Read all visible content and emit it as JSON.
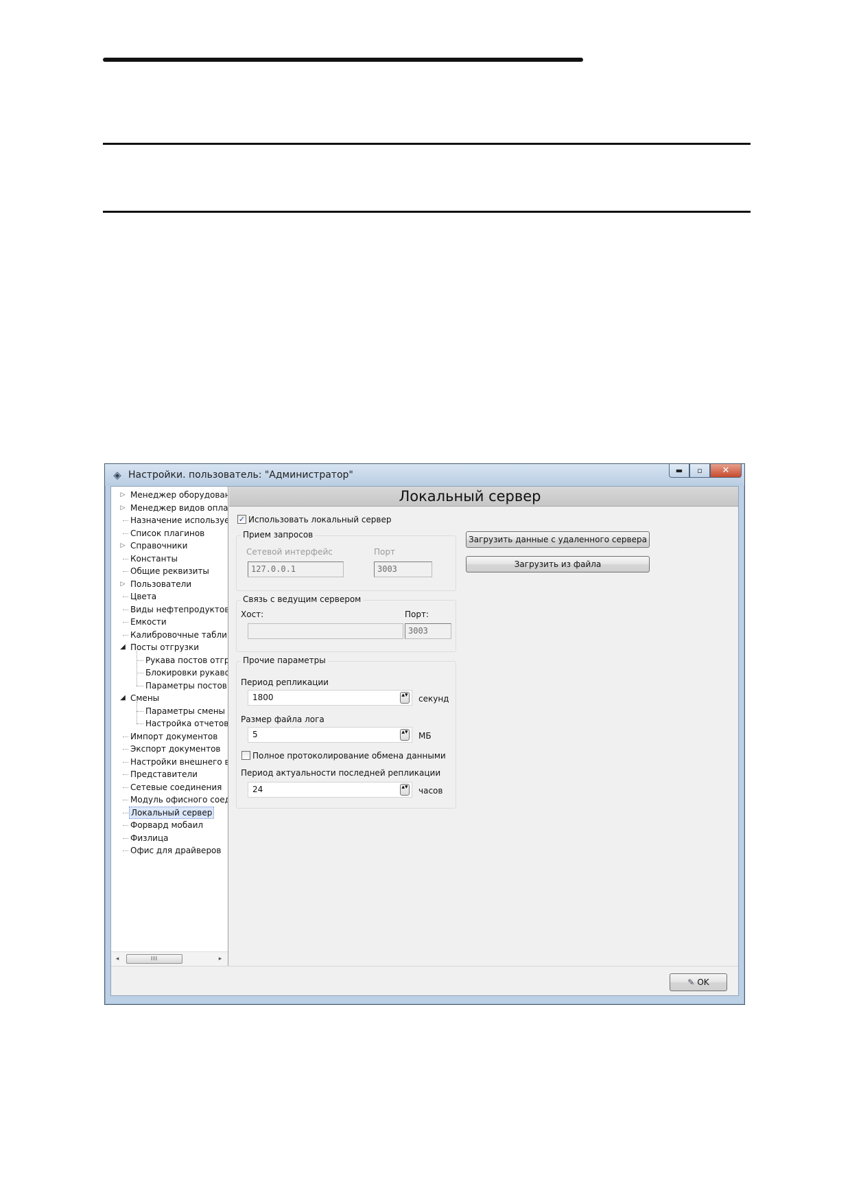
{
  "window": {
    "title": "Настройки. пользователь: \"Администратор\"",
    "minimize_glyph": "▬",
    "maximize_glyph": "▫",
    "close_glyph": "✕"
  },
  "tree": {
    "items": [
      {
        "label": "Менеджер оборудовани",
        "glyph": "▷"
      },
      {
        "label": "Менеджер видов оплат",
        "glyph": "▷"
      },
      {
        "label": "Назначение используем",
        "glyph": ""
      },
      {
        "label": "Список плагинов",
        "glyph": ""
      },
      {
        "label": "Справочники",
        "glyph": "▷"
      },
      {
        "label": "Константы",
        "glyph": ""
      },
      {
        "label": "Общие реквизиты",
        "glyph": ""
      },
      {
        "label": "Пользователи",
        "glyph": "▷"
      },
      {
        "label": "Цвета",
        "glyph": ""
      },
      {
        "label": "Виды нефтепродуктов",
        "glyph": ""
      },
      {
        "label": "Емкости",
        "glyph": ""
      },
      {
        "label": "Калибровочные таблиц",
        "glyph": ""
      },
      {
        "label": "Посты отгрузки",
        "glyph": "◢"
      },
      {
        "label": "Рукава постов отгр",
        "glyph": ""
      },
      {
        "label": "Блокировки рукаво",
        "glyph": ""
      },
      {
        "label": "Параметры постов с",
        "glyph": ""
      },
      {
        "label": "Смены",
        "glyph": "◢"
      },
      {
        "label": "Параметры смены",
        "glyph": ""
      },
      {
        "label": "Настройка отчетов",
        "glyph": ""
      },
      {
        "label": "Импорт документов",
        "glyph": ""
      },
      {
        "label": "Экспорт документов",
        "glyph": ""
      },
      {
        "label": "Настройки внешнего ви",
        "glyph": ""
      },
      {
        "label": "Представители",
        "glyph": ""
      },
      {
        "label": "Сетевые соединения",
        "glyph": ""
      },
      {
        "label": "Модуль офисного соеди",
        "glyph": ""
      },
      {
        "label": "Локальный сервер",
        "glyph": ""
      },
      {
        "label": "Форвард мобаил",
        "glyph": ""
      },
      {
        "label": "Физлица",
        "glyph": ""
      },
      {
        "label": "Офис для драйверов",
        "glyph": ""
      }
    ],
    "scroll": {
      "left": "◂",
      "right": "▸",
      "thumb": "III"
    }
  },
  "panel": {
    "title": "Локальный сервер",
    "use_local_server": {
      "label": "Использовать локальный сервер",
      "checked": true,
      "mark": "✓"
    },
    "requests": {
      "legend": "Прием запросов",
      "interface_label": "Сетевой интерфейс",
      "interface_value": "127.0.0.1",
      "port_label": "Порт",
      "port_value": "3003"
    },
    "master": {
      "legend": "Связь с ведущим сервером",
      "host_label": "Хост:",
      "host_value": "",
      "port_label": "Порт:",
      "port_value": "3003"
    },
    "other": {
      "legend": "Прочие параметры",
      "replication_label": "Период репликации",
      "replication_value": "1800",
      "replication_unit": "секунд",
      "logsize_label": "Размер файла лога",
      "logsize_value": "5",
      "logsize_unit": "МБ",
      "full_logging_label": "Полное протоколирование обмена данными",
      "full_logging_checked": false,
      "actuality_label": "Период актуальности последней репликации",
      "actuality_value": "24",
      "actuality_unit": "часов",
      "spin_glyph": "▲▼"
    },
    "load_remote_button": "Загрузить данные с удаленного сервера",
    "load_file_button": "Загрузить из файла"
  },
  "footer": {
    "ok_label": "OK",
    "ok_icon": "✎"
  }
}
